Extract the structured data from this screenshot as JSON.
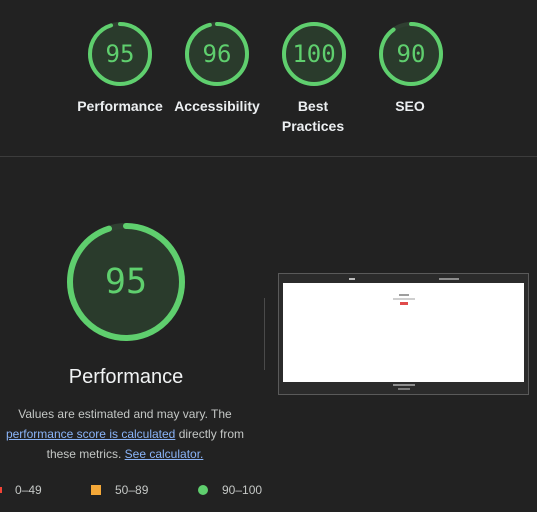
{
  "scores": [
    {
      "label": "Performance",
      "value": "95",
      "fraction": 0.95
    },
    {
      "label": "Accessibility",
      "value": "96",
      "fraction": 0.96
    },
    {
      "label": "Best Practices",
      "value": "100",
      "fraction": 1.0
    },
    {
      "label": "SEO",
      "value": "90",
      "fraction": 0.9
    }
  ],
  "main": {
    "score": "95",
    "fraction": 0.95,
    "title": "Performance",
    "desc_before": "Values are estimated and may vary. The",
    "desc_link1": "performance score is calculated",
    "desc_middle": " directly from these metrics.",
    "desc_link2": "See calculator."
  },
  "legend": {
    "fail": "0–49",
    "average": "50–89",
    "pass": "90–100"
  },
  "colors": {
    "pass": "#5fcf6e",
    "average": "#f4a838",
    "fail": "#f44336",
    "link": "#8ab4f8"
  },
  "screenshot": {
    "button_color": "#e04b4b"
  }
}
